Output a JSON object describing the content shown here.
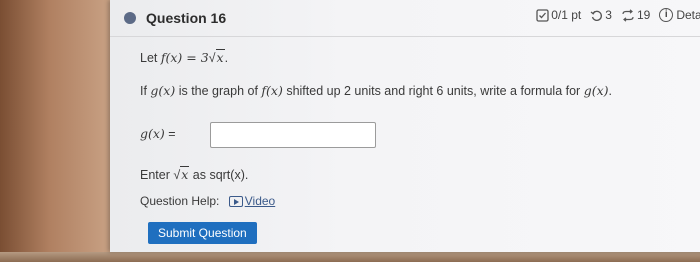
{
  "question": {
    "title": "Question 16",
    "score": "0/1 pt",
    "retries": "3",
    "attempts": "19",
    "details": "Details"
  },
  "prompt": {
    "let_prefix": "Let ",
    "f_def_lhs": "f(x) = 3",
    "f_def_arg": "x",
    "let_suffix": ".",
    "p2_a": "If ",
    "p2_g": "g(x)",
    "p2_b": " is the graph of ",
    "p2_f": "f(x)",
    "p2_c": " shifted up 2 units and right 6 units, write a formula for ",
    "p2_g2": "g(x)",
    "p2_d": "."
  },
  "answer": {
    "label": "g(x)",
    "equals": " =",
    "value": ""
  },
  "hint": {
    "prefix": "Enter ",
    "arg": "x",
    "suffix": " as sqrt(x)."
  },
  "help": {
    "label": "Question Help:",
    "video": "Video"
  },
  "submit_label": "Submit Question",
  "colors": {
    "accent": "#1f6fbf",
    "status_dot": "#5c6a86"
  },
  "icons": [
    "checkbox-icon",
    "retry-icon",
    "attempts-icon",
    "info-icon",
    "video-icon"
  ]
}
